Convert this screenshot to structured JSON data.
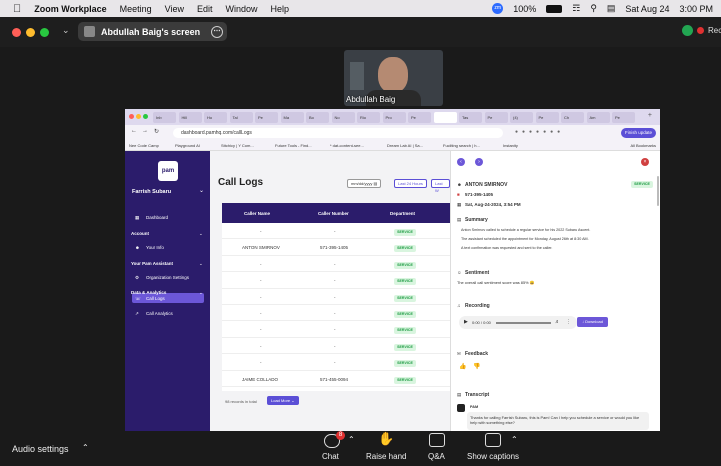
{
  "menubar": {
    "apple": "",
    "app": "Zoom Workplace",
    "items": [
      "Meeting",
      "View",
      "Edit",
      "Window",
      "Help"
    ],
    "battery": "100%",
    "date": "Sat Aug 24",
    "time": "3:00 PM",
    "zoom_badge": "zm"
  },
  "zoom": {
    "share_title": "Abdullah Baig's screen",
    "rec_label": "Rec",
    "participant": "Abdullah Baig"
  },
  "browser": {
    "url": "dashboard.pamhq.com/callLogs",
    "finish_update": "Finish update",
    "bookmarks": [
      "Nee Code Camp",
      "Playground AI",
      "Sttchicy | Y Com...",
      "Future Tools - Find...",
      "* dat-content-see...",
      "Dream Lab AI | Sa...",
      "Fucilting search | h...",
      "Instanity"
    ],
    "all_bookmarks": "All Bookmarks"
  },
  "sidebar": {
    "org": "Farrish Subaru",
    "logo": "pam",
    "items": [
      {
        "label": "Dashboard"
      },
      {
        "label": "Account",
        "header": true
      },
      {
        "label": "Your Info"
      },
      {
        "label": "Your Pam Assistant",
        "header": true
      },
      {
        "label": "Organization Settings"
      },
      {
        "label": "Data & Analytics",
        "header": true
      },
      {
        "label": "Call Logs",
        "active": true
      },
      {
        "label": "Call Analytics"
      }
    ]
  },
  "main": {
    "title": "Call Logs",
    "date_placeholder": "mm/dd/yyyy",
    "filters": [
      "Last 24 Hours",
      "Last W"
    ],
    "columns": [
      "Caller Name",
      "Caller Number",
      "Department"
    ],
    "rows": [
      {
        "name": "-",
        "number": "-",
        "dept": "SERVICE"
      },
      {
        "name": "ANTON SMIRNOV",
        "number": "571-395-1405",
        "dept": "SERVICE"
      },
      {
        "name": "-",
        "number": "-",
        "dept": "SERVICE"
      },
      {
        "name": "-",
        "number": "-",
        "dept": "SERVICE"
      },
      {
        "name": "-",
        "number": "-",
        "dept": "SERVICE"
      },
      {
        "name": "-",
        "number": "-",
        "dept": "SERVICE"
      },
      {
        "name": "-",
        "number": "-",
        "dept": "SERVICE"
      },
      {
        "name": "-",
        "number": "-",
        "dept": "SERVICE"
      },
      {
        "name": "-",
        "number": "-",
        "dept": "SERVICE"
      },
      {
        "name": "JAIME COLLADO",
        "number": "571-455-0094",
        "dept": "SERVICE"
      }
    ],
    "footer": "98 records in total",
    "load_more": "Load More"
  },
  "panel": {
    "caller": "ANTON SMIRNOV",
    "phone": "571-395-1405",
    "datetime": "Sat, Aug-24-2024, 3:54 PM",
    "dept": "SERVICE",
    "summary_title": "Summary",
    "summary": [
      "Anton Smirnov called to schedule a regular service for his 2022 Subaru Ascent.",
      "The assistant scheduled the appointment for Monday, August 26th at 8:30 AM.",
      "A text confirmation was requested and sent to the caller."
    ],
    "sentiment_title": "Sentiment",
    "sentiment": "The overall call sentiment score was 85% 😀",
    "recording_title": "Recording",
    "audio_time": "0:00 / 0:00",
    "download": "Download",
    "feedback_title": "Feedback",
    "transcript_title": "Transcript",
    "speaker": "PAM",
    "message": "Thanks for calling Farrish Subaru, this is Pam! Can I help you schedule a service or would you like help with something else?"
  },
  "bottom": {
    "audio_settings": "Audio settings",
    "chat": "Chat",
    "chat_badge": "8",
    "raise_hand": "Raise hand",
    "qa": "Q&A",
    "captions": "Show captions"
  }
}
